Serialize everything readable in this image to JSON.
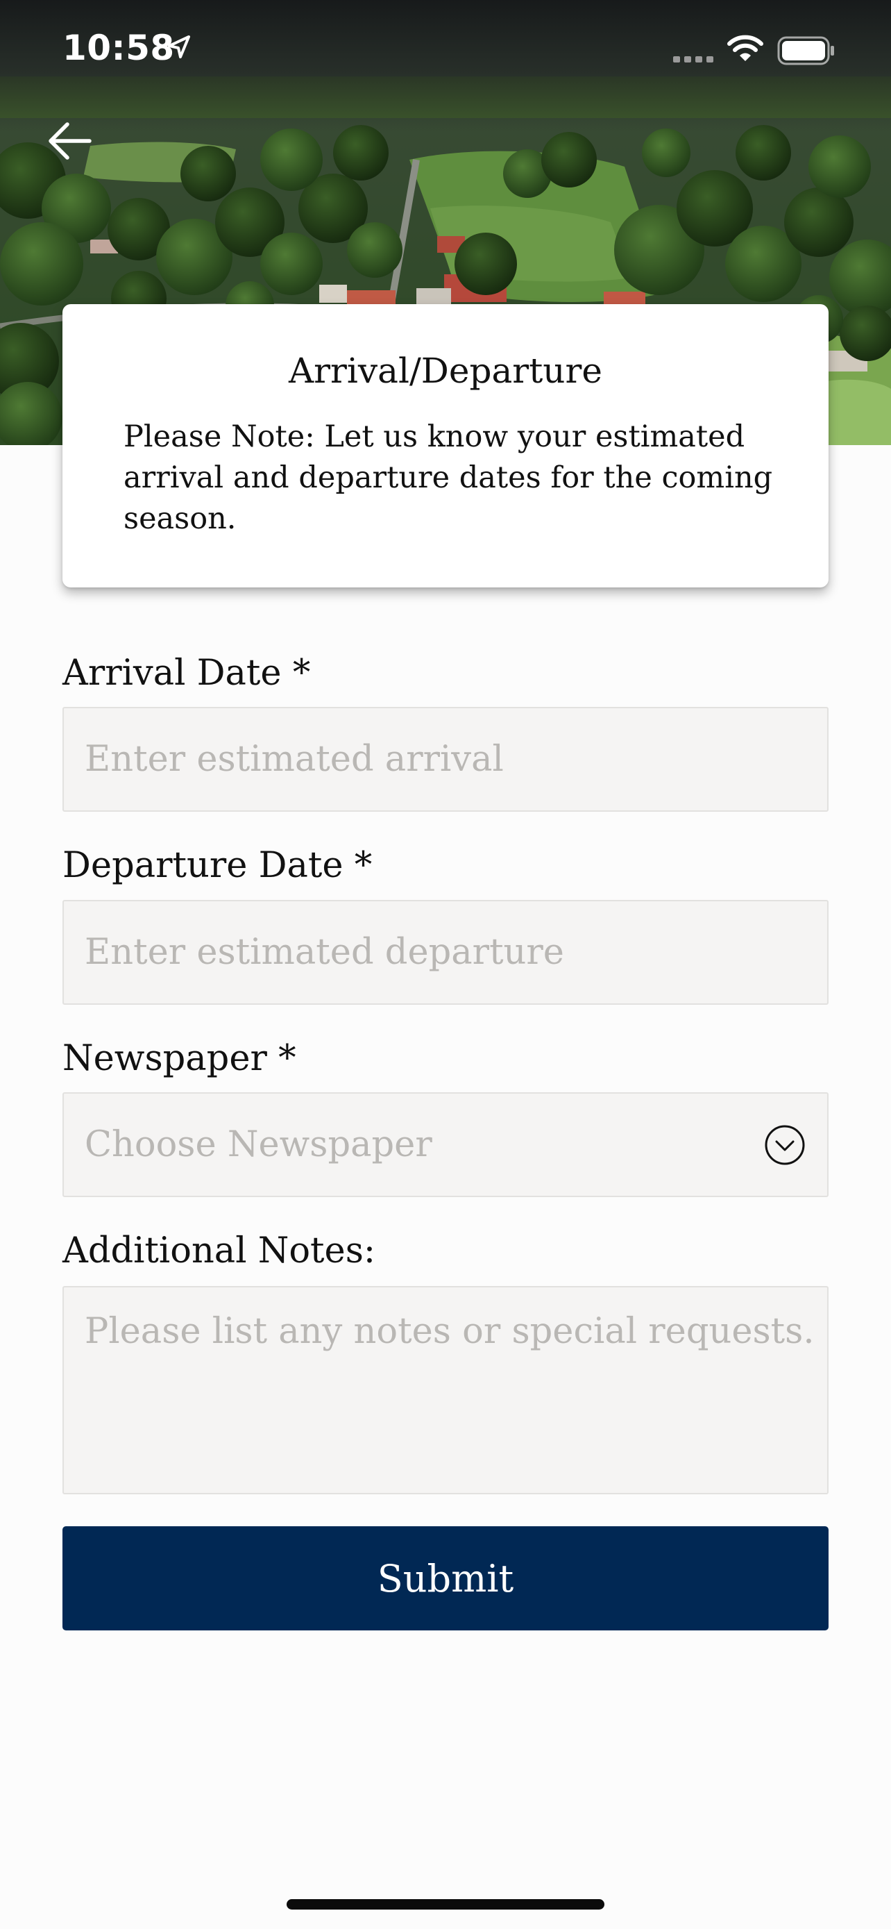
{
  "status_bar": {
    "time": "10:58",
    "location_icon": "location-arrow-icon",
    "signal_icon": "cellular-signal-icon",
    "wifi_icon": "wifi-icon",
    "battery_icon": "battery-full-icon"
  },
  "hero": {
    "image": "aerial-golf-course-photo"
  },
  "nav": {
    "back_icon": "arrow-left-icon"
  },
  "note_card": {
    "title": "Arrival/Departure",
    "body": "Please Note: Let us know your estimated arrival and departure dates for the coming season."
  },
  "form": {
    "arrival": {
      "label": "Arrival Date *",
      "placeholder": "Enter estimated arrival"
    },
    "departure": {
      "label": "Departure Date *",
      "placeholder": "Enter estimated departure"
    },
    "newspaper": {
      "label": "Newspaper *",
      "placeholder": "Choose Newspaper",
      "icon": "chevron-down-circle-icon"
    },
    "notes": {
      "label": "Additional Notes:",
      "placeholder": "Please list any notes or special requests."
    },
    "submit_label": "Submit"
  },
  "colors": {
    "primary": "#012854",
    "field_background": "#f5f4f3",
    "placeholder": "#b9b7b4",
    "page_background": "#fcfcfc"
  }
}
